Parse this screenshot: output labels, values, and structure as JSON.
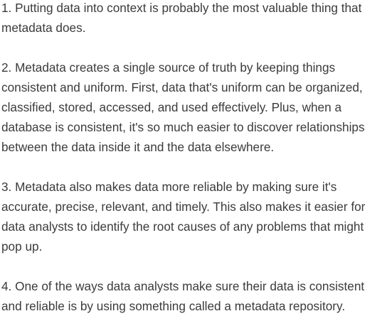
{
  "content": {
    "paragraphs": [
      "1. Putting data into context is probably the most valuable thing that metadata does.",
      "2. Metadata creates a single source of truth by keeping things consistent and uniform. First, data that's uniform can be organized, classified, stored, accessed, and used effectively. Plus, when a database is consistent, it's so much easier to discover relationships between the data inside it and the data elsewhere.",
      "3. Metadata also makes data more reliable by making sure it's accurate, precise, relevant, and timely. This also makes it easier for data analysts to identify the root causes of any problems that might pop up.",
      "4. One of the ways data analysts make sure their data is consistent and reliable is by using something called a metadata repository."
    ]
  }
}
